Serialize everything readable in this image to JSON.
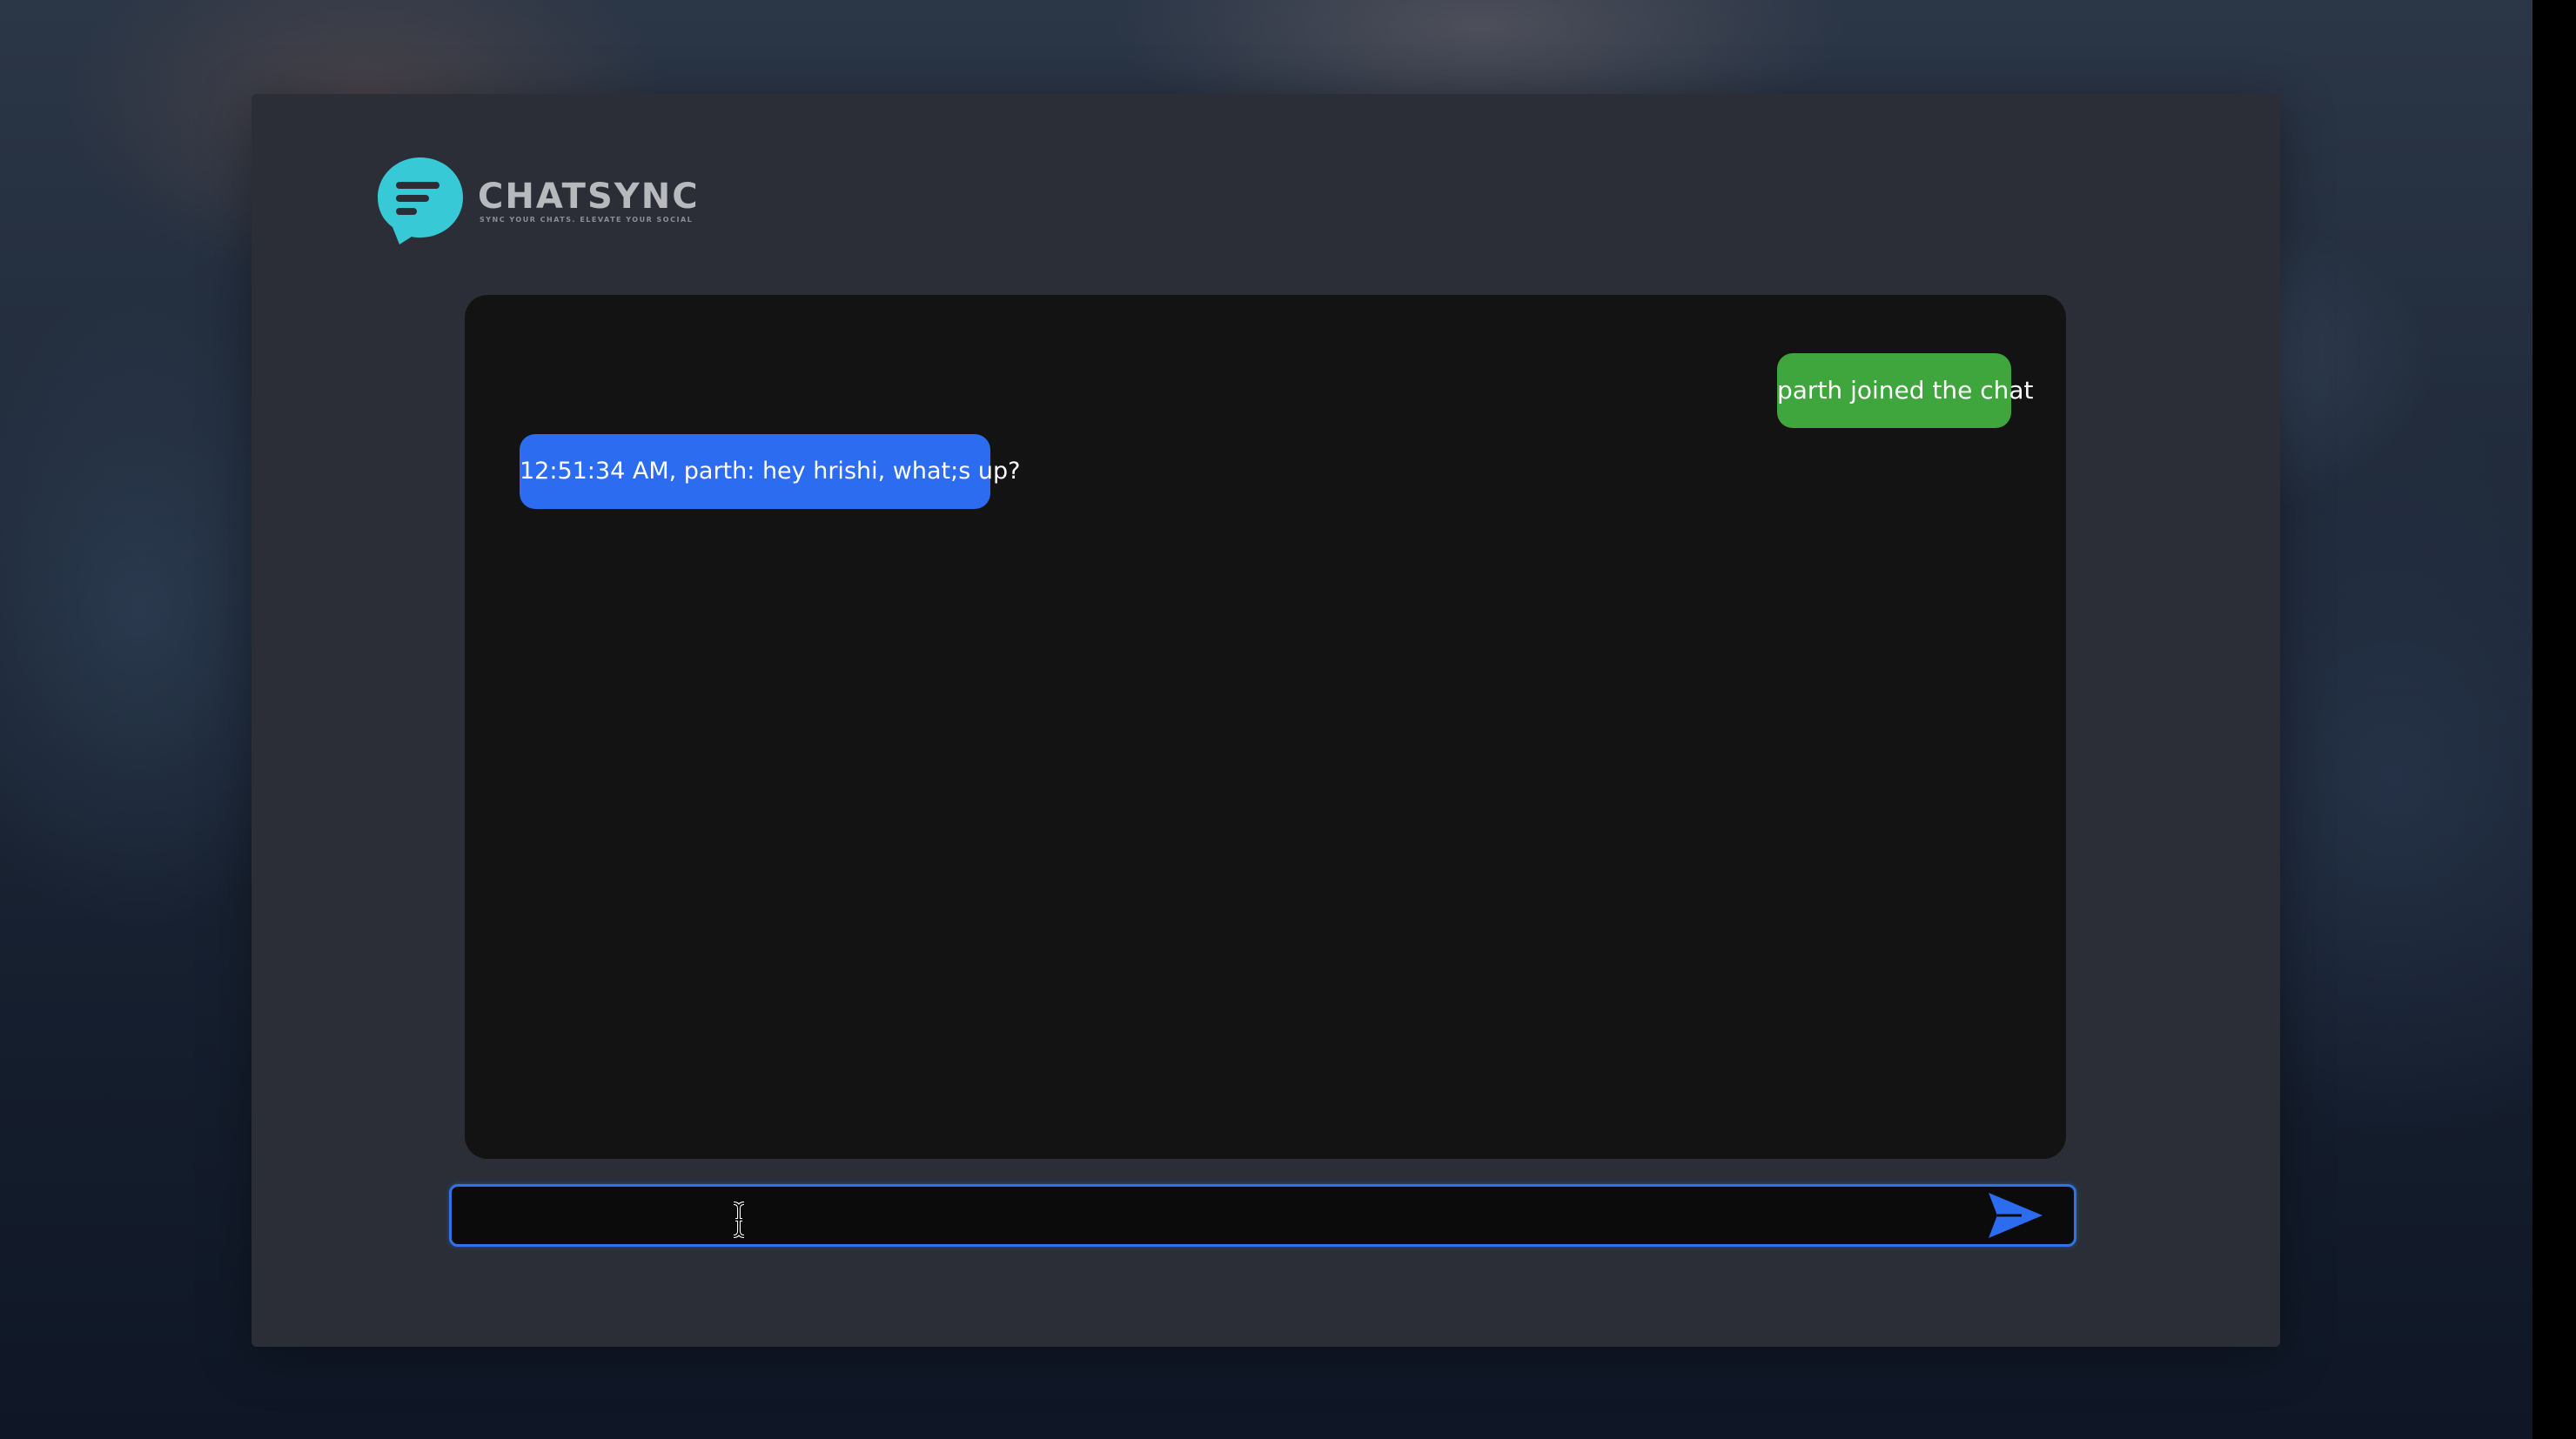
{
  "app": {
    "name": "CHATSYNC",
    "tagline": "SYNC YOUR CHATS. ELEVATE YOUR SOCIAL",
    "logo_icon": "chat-bubble-lines-icon"
  },
  "messages": [
    {
      "type": "system",
      "text": "parth joined the chat",
      "align": "right",
      "color": "#3ea63c"
    },
    {
      "type": "user",
      "text": "12:51:34 AM, parth: hey hrishi, what;s up?",
      "align": "left",
      "color": "#2c6cf0"
    }
  ],
  "composer": {
    "value": "",
    "placeholder": "",
    "send_icon": "send-arrow-icon"
  },
  "colors": {
    "accent": "#2f73e6",
    "logo": "#38c9d6",
    "panel": "#2b2e37",
    "chat_background": "#131313"
  }
}
